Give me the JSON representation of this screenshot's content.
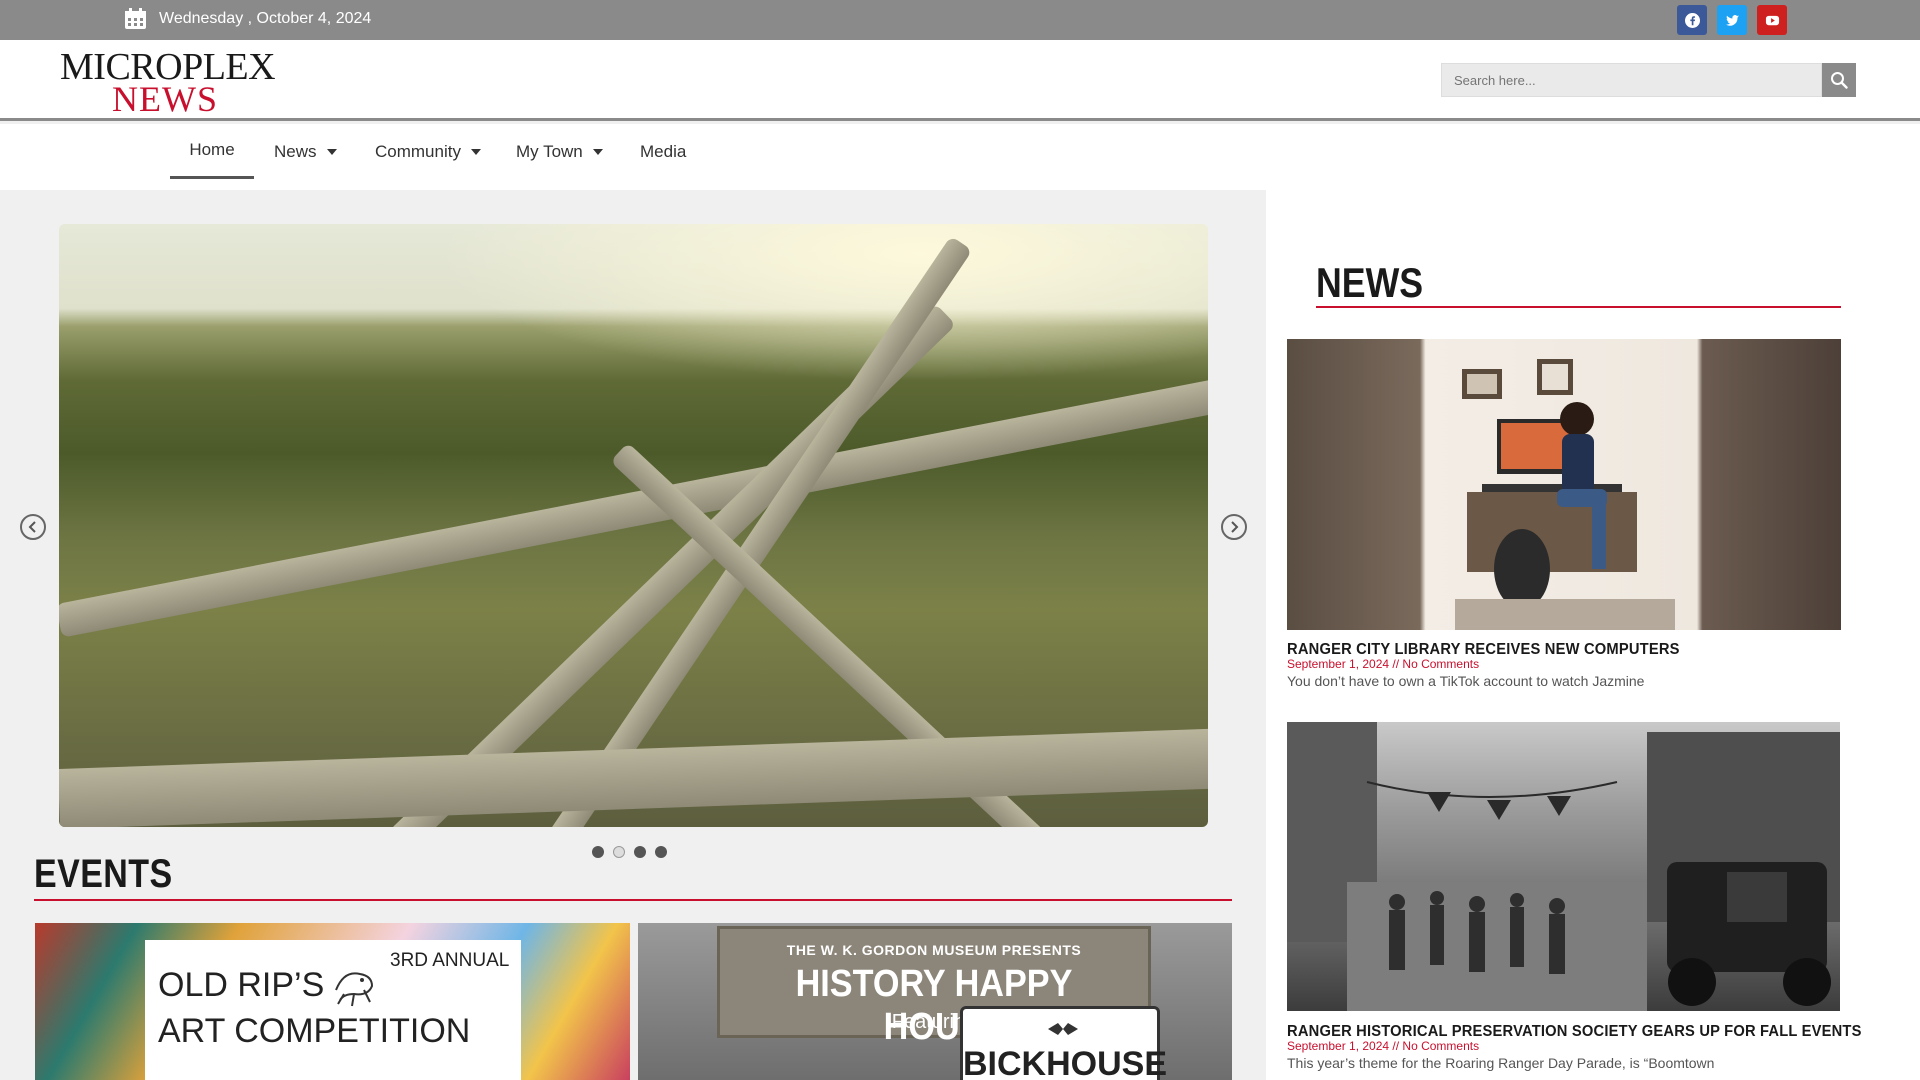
{
  "topbar": {
    "date": "Wednesday , October 4, 2024",
    "social": [
      "facebook-icon",
      "twitter-icon",
      "youtube-icon"
    ]
  },
  "header": {
    "logo_line1": "MICROPLEX",
    "logo_line2": "NEWS",
    "search_placeholder": "Search here..."
  },
  "nav": {
    "items": [
      {
        "label": "Home"
      },
      {
        "label": "News"
      },
      {
        "label": "Community"
      },
      {
        "label": "My Town"
      },
      {
        "label": "Media"
      }
    ]
  },
  "events": {
    "title": "EVENTS",
    "card1": {
      "line1": "OLD RIP’S",
      "line2": "ART COMPETITION",
      "badge": "3RD ANNUAL"
    },
    "card2": {
      "presenter": "THE W. K. GORDON MUSEUM PRESENTS",
      "title": "HISTORY HAPPY HOUR",
      "featuring": "Featuring",
      "sponsor": "BICKHOUSE"
    }
  },
  "sidebar": {
    "title": "NEWS",
    "articles": [
      {
        "title": "RANGER CITY LIBRARY RECEIVES NEW COMPUTERS",
        "meta": "September 1, 2024 // No Comments",
        "excerpt": "You don’t have to own a TikTok account to watch Jazmine"
      },
      {
        "title": "RANGER HISTORICAL PRESERVATION SOCIETY GEARS UP FOR FALL EVENTS",
        "meta": "September 1, 2024 // No Comments",
        "excerpt": "This year’s theme for the Roaring Ranger Day Parade, is “Boomtown"
      }
    ]
  },
  "colors": {
    "accent": "#c8102e",
    "topbar": "#8a8a8a"
  }
}
